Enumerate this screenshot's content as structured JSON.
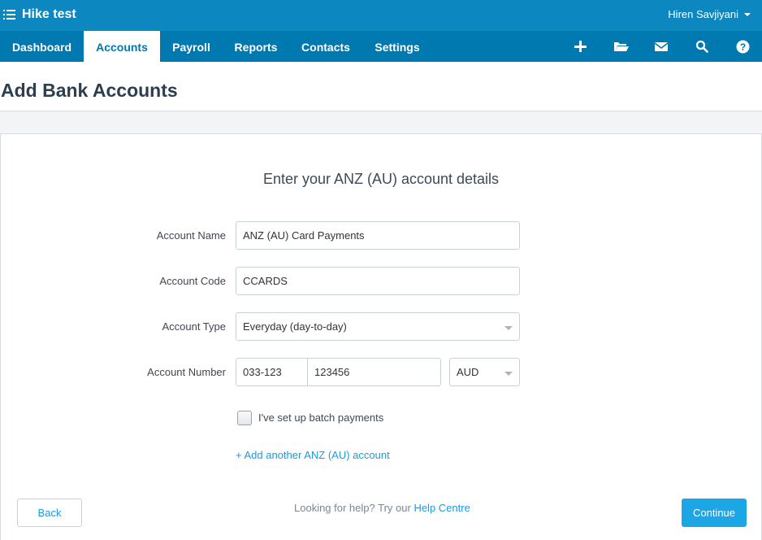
{
  "header": {
    "org_name": "Hike test",
    "user_name": "Hiren Savjiyani"
  },
  "nav": {
    "tabs": [
      {
        "label": "Dashboard",
        "active": false
      },
      {
        "label": "Accounts",
        "active": true
      },
      {
        "label": "Payroll",
        "active": false
      },
      {
        "label": "Reports",
        "active": false
      },
      {
        "label": "Contacts",
        "active": false
      },
      {
        "label": "Settings",
        "active": false
      }
    ],
    "icons": [
      "plus-icon",
      "folder-icon",
      "mail-icon",
      "search-icon",
      "help-icon"
    ]
  },
  "page": {
    "title": "Add Bank Accounts"
  },
  "form": {
    "heading": "Enter your ANZ (AU) account details",
    "account_name": {
      "label": "Account Name",
      "value": "ANZ (AU) Card Payments"
    },
    "account_code": {
      "label": "Account Code",
      "value": "CCARDS"
    },
    "account_type": {
      "label": "Account Type",
      "value": "Everyday (day-to-day)"
    },
    "account_number": {
      "label": "Account Number",
      "bsb": "033-123",
      "number": "123456",
      "currency": "AUD"
    },
    "batch_payments": {
      "label": "I've set up batch payments",
      "checked": false
    },
    "add_another": "+ Add another ANZ (AU) account"
  },
  "footer": {
    "back_label": "Back",
    "help_prefix": "Looking for help? Try our",
    "help_link": "Help Centre",
    "continue_label": "Continue"
  },
  "colors": {
    "topbar": "#0d87bf",
    "navbar": "#0079b1",
    "link": "#1a9be0",
    "primary_button": "#1ca6e6"
  }
}
